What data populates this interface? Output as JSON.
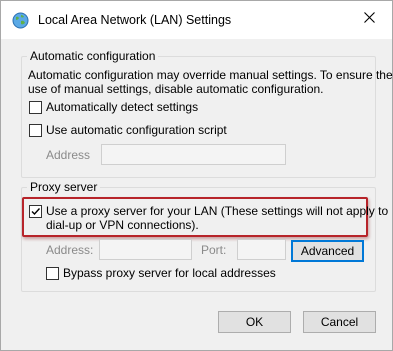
{
  "window": {
    "title": "Local Area Network (LAN) Settings",
    "icons": {
      "app": "network-globe-icon",
      "close": "close-icon"
    }
  },
  "auto_config": {
    "legend": "Automatic configuration",
    "description_line1": "Automatic configuration may override manual settings.  To ensure the",
    "description_line2": "use of manual settings, disable automatic configuration.",
    "detect_label": "Automatically detect settings",
    "detect_checked": false,
    "script_label": "Use automatic configuration script",
    "script_checked": false,
    "address_label": "Address",
    "address_value": ""
  },
  "proxy": {
    "legend": "Proxy server",
    "use_proxy_label_line1": "Use a proxy server for your LAN (These settings will not apply to",
    "use_proxy_label_line2": "dial-up or VPN connections).",
    "use_proxy_checked": true,
    "address_label": "Address:",
    "address_value": "",
    "port_label": "Port:",
    "port_value": "",
    "advanced_label": "Advanced",
    "bypass_label": "Bypass proxy server for local addresses",
    "bypass_checked": false
  },
  "footer": {
    "ok_label": "OK",
    "cancel_label": "Cancel"
  },
  "colors": {
    "highlight": "#b7242a",
    "accent": "#0078d7"
  }
}
